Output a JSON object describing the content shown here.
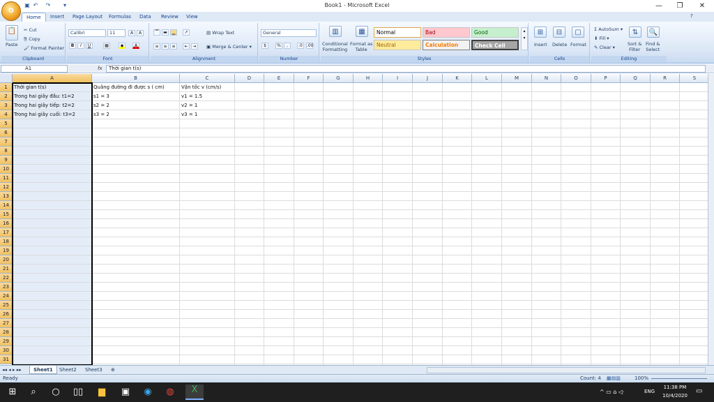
{
  "window": {
    "title": "Book1 - Microsoft Excel",
    "office_button_label": "O"
  },
  "qat": [
    "save-icon",
    "undo-icon",
    "redo-icon",
    "customize-icon"
  ],
  "tabs": [
    "Home",
    "Insert",
    "Page Layout",
    "Formulas",
    "Data",
    "Review",
    "View"
  ],
  "ribbon": {
    "clipboard": {
      "label": "Clipboard",
      "paste": "Paste",
      "cut": "Cut",
      "copy": "Copy",
      "format_painter": "Format Painter"
    },
    "font": {
      "label": "Font",
      "name": "Calibri",
      "size": "11",
      "bold": "B",
      "italic": "I",
      "underline": "U",
      "grow": "A",
      "shrink": "A"
    },
    "alignment": {
      "label": "Alignment",
      "wrap": "Wrap Text",
      "merge": "Merge & Center"
    },
    "number": {
      "label": "Number",
      "format": "General",
      "currency": "$",
      "percent": "%",
      "comma": ",",
      "inc": ".0",
      "dec": ".00"
    },
    "styles": {
      "label": "Styles",
      "conditional": "Conditional\nFormatting",
      "format_table": "Format as\nTable",
      "normal": "Normal",
      "bad": "Bad",
      "good": "Good",
      "neutral": "Neutral",
      "calculation": "Calculation",
      "check_cell": "Check Cell"
    },
    "cells": {
      "label": "Cells",
      "insert": "Insert",
      "delete": "Delete",
      "format": "Format"
    },
    "editing": {
      "label": "Editing",
      "autosum": "AutoSum",
      "fill": "Fill",
      "clear": "Clear",
      "sort": "Sort &\nFilter",
      "find": "Find &\nSelect"
    }
  },
  "formula_bar": {
    "name_box": "A1",
    "fx": "fx",
    "value": "Thời gian  t(s)"
  },
  "columns": [
    "A",
    "B",
    "C",
    "D",
    "E",
    "F",
    "G",
    "H",
    "I",
    "J",
    "K",
    "L",
    "M",
    "N",
    "O",
    "P",
    "Q",
    "R",
    "S"
  ],
  "rows": [
    "1",
    "2",
    "3",
    "4",
    "5",
    "6",
    "7",
    "8",
    "9",
    "10",
    "11",
    "12",
    "13",
    "14",
    "15",
    "16",
    "17",
    "18",
    "19",
    "20",
    "21",
    "22",
    "23",
    "24",
    "25",
    "26",
    "27",
    "28",
    "29",
    "30",
    "31"
  ],
  "cells": [
    {
      "r": 0,
      "c": 0,
      "v": "Thời gian  t(s)"
    },
    {
      "r": 0,
      "c": 1,
      "v": "Quãng đường đi được s ( cm)"
    },
    {
      "r": 0,
      "c": 2,
      "v": "Vận tốc v (cm/s)"
    },
    {
      "r": 1,
      "c": 0,
      "v": "Trong hai giây đầu: t1=2"
    },
    {
      "r": 1,
      "c": 1,
      "v": "s1 = 3"
    },
    {
      "r": 1,
      "c": 2,
      "v": "v1 = 1.5"
    },
    {
      "r": 2,
      "c": 0,
      "v": "Trong hai giây tiếp: t2=2"
    },
    {
      "r": 2,
      "c": 1,
      "v": "s2 = 2"
    },
    {
      "r": 2,
      "c": 2,
      "v": "v2 = 1"
    },
    {
      "r": 3,
      "c": 0,
      "v": "Trong hai giây cuối: t3=2"
    },
    {
      "r": 3,
      "c": 1,
      "v": "s3 = 2"
    },
    {
      "r": 3,
      "c": 2,
      "v": "v3 = 1"
    }
  ],
  "sheets": [
    "Sheet1",
    "Sheet2",
    "Sheet3"
  ],
  "status": {
    "ready": "Ready",
    "count": "Count: 4",
    "zoom": "100%"
  },
  "taskbar": {
    "time": "11:38 PM",
    "date": "10/4/2020",
    "lang": "ENG"
  }
}
